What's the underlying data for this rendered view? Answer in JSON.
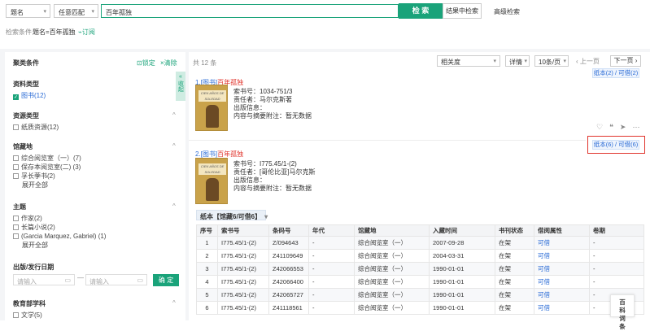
{
  "search": {
    "field_select": "题名",
    "match_select": "任意匹配",
    "query": "百年孤独",
    "search_button": "检 索",
    "in_results_button": "结果中检索",
    "advanced_link": "高级检索",
    "condition_label": "检索条件",
    "condition_value": "题名=百年孤独",
    "subscribe_label": "订阅"
  },
  "sidebar": {
    "title": "聚类条件",
    "lock_label": "锁定",
    "clear_label": "清除",
    "collapse_label": "收起",
    "sections": {
      "resource_type": {
        "title": "资料类型",
        "items": [
          "图书(12)"
        ]
      },
      "resource_source": {
        "title": "资源类型",
        "items": [
          "纸质资源(12)"
        ]
      },
      "location": {
        "title": "馆藏地",
        "items": [
          "综合阅览室（一）(7)",
          "保存本阅览室(二) (3)",
          "孚长荸书(2)"
        ],
        "more": "展开全部"
      },
      "subject": {
        "title": "主题",
        "items": [
          "作家(2)",
          "长篇小说(2)",
          "(Garcia Marquez, Gabriel) (1)"
        ],
        "more": "展开全部"
      },
      "pubdate": {
        "title": "出版/发行日期",
        "from_placeholder": "请输入",
        "to_placeholder": "请输入",
        "confirm": "确 定"
      },
      "discipline": {
        "title": "教育部学科",
        "items": [
          "文学(5)"
        ]
      }
    }
  },
  "results": {
    "count_label": "共 12 条",
    "sort_select": "相关度",
    "view_select": "详情",
    "page_size_select": "10条/页",
    "prev_label": "上一页",
    "next_label": "下一页",
    "items": [
      {
        "index": "1.",
        "type": "[图书]",
        "title": "百年孤独",
        "call_no": "索书号：1034-751/3",
        "responsible": "责任者：马尔克斯著",
        "publish": "出版信息：",
        "abstract": "内容与摘要附注：暂无数据",
        "holdings": "纸本(2) / 可借(2)",
        "cover_title": "CIEN AÑOS DE SOLEDAD",
        "cover_sub": "百年孤独"
      },
      {
        "index": "2.",
        "type": "[图书]",
        "title": "百年孤独",
        "call_no": "索书号：I775.45/1-(2)",
        "responsible": "责任者：[哥伦比亚]马尔克斯",
        "publish": "出版信息：",
        "abstract": "内容与摘要附注：暂无数据",
        "holdings": "纸本(6) / 可借(6)",
        "cover_title": "CIEN AÑOS DE SOLEDAD",
        "cover_sub": "百年孤独"
      }
    ],
    "holdings_tab": "纸本【馆藏6/可借6】",
    "table": {
      "headers": [
        "序号",
        "索书号",
        "条码号",
        "年代",
        "馆藏地",
        "入藏时间",
        "书刊状态",
        "借阅属性",
        "卷期"
      ],
      "rows": [
        [
          "1",
          "I775.45/1-(2)",
          "Z/094643",
          "-",
          "综合阅览室（一）",
          "2007-09-28",
          "在架",
          "可借",
          "-"
        ],
        [
          "2",
          "I775.45/1-(2)",
          "Z41109649",
          "-",
          "综合阅览室（一）",
          "2004-03-31",
          "在架",
          "可借",
          "-"
        ],
        [
          "3",
          "I775.45/1-(2)",
          "Z42066553",
          "-",
          "综合阅览室（一）",
          "1990-01-01",
          "在架",
          "可借",
          "-"
        ],
        [
          "4",
          "I775.45/1-(2)",
          "Z42066400",
          "-",
          "综合阅览室（一）",
          "1990-01-01",
          "在架",
          "可借",
          "-"
        ],
        [
          "5",
          "I775.45/1-(2)",
          "Z42065727",
          "-",
          "综合阅览室（一）",
          "1990-01-01",
          "在架",
          "可借",
          "-"
        ],
        [
          "6",
          "I775.45/1-(2)",
          "Z41118561",
          "-",
          "综合阅览室（一）",
          "1990-01-01",
          "在架",
          "可借",
          "-"
        ]
      ]
    },
    "baike_label": "百科词条"
  },
  "colors": {
    "accent": "#1aa37a",
    "link": "#2a6bd6",
    "title_red": "#e0342c",
    "highlight": "#e0342c"
  }
}
